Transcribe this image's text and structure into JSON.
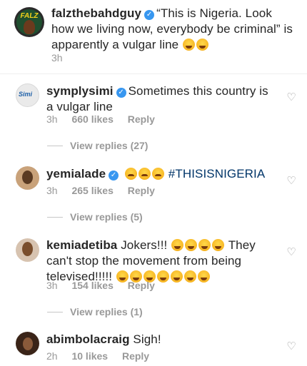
{
  "post": {
    "username": "falzthebahdguy",
    "caption": "“This is Nigeria. Look how we living now, everybody be criminal” is apparently a vulgar line",
    "caption_emojis": [
      "joy-emoji",
      "rofl-emoji"
    ],
    "time": "3h",
    "avatar_text": "FALZ"
  },
  "comments": [
    {
      "username": "symplysimi",
      "verified": true,
      "text": "Sometimes this country is a vulgar line",
      "time": "3h",
      "likes": "660 likes",
      "reply": "Reply",
      "view_replies": "View replies (27)"
    },
    {
      "username": "yemialade",
      "verified": true,
      "text": "#THISISNIGERIA",
      "time": "3h",
      "likes": "265 likes",
      "reply": "Reply",
      "view_replies": "View replies (5)"
    },
    {
      "username": "kemiadetiba",
      "verified": false,
      "text1": "Jokers!!!",
      "text2": "They can't stop the movement from being televised!!!!!",
      "time": "3h",
      "likes": "154 likes",
      "reply": "Reply",
      "view_replies": "View replies (1)"
    },
    {
      "username": "abimbolacraig",
      "verified": false,
      "text": "Sigh!",
      "time": "2h",
      "likes": "10 likes",
      "reply": "Reply"
    }
  ],
  "colors": {
    "verified": "#3897f0",
    "meta": "#999999",
    "text": "#262626"
  }
}
